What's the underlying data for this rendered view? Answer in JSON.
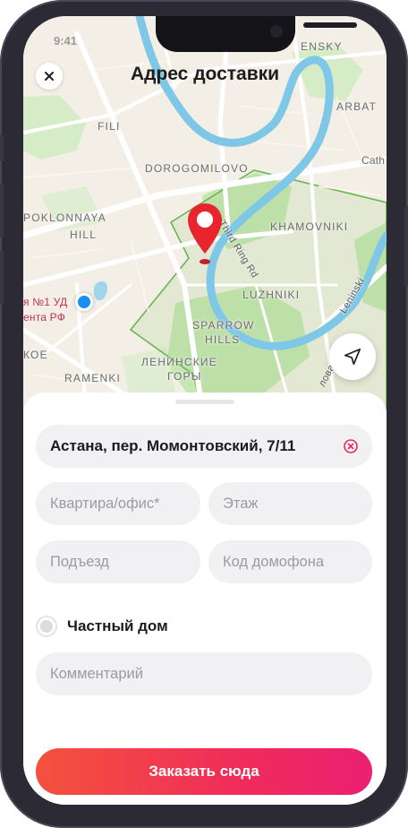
{
  "status": {
    "time": "9:41"
  },
  "header": {
    "title": "Адрес доставки"
  },
  "map": {
    "labels": {
      "fili": "FILI",
      "dorogomilovo": "DOROGOMILOVO",
      "arbat": "ARBAT",
      "cath": "Cath",
      "poklonnaya1": "POKLONNAYA",
      "poklonnaya2": "HILL",
      "khamovniki": "KHAMOVNIKI",
      "third_ring": "Third Ring Rd",
      "luzhniki": "LUZHNIKI",
      "leninski": "Leninski",
      "sparrow1": "SPARROW",
      "sparrow2": "HILLS",
      "lenin1": "ЛЕНИНСКИЕ",
      "lenin2": "ГОРЫ",
      "ramenki": "RAMENKI",
      "koe": "КОЕ",
      "ud": "я №1 УД",
      "rf": "ента РФ",
      "ensky": "ENSKY",
      "lova": "лова"
    },
    "colors": {
      "land": "#f3efe6",
      "park": "#c6e6b3",
      "water": "#7ec7e6",
      "road": "#ffffff",
      "zone": "#69b552",
      "pin": "#e8242e",
      "user_dot": "#1a8ff0"
    }
  },
  "form": {
    "address": "Астана, пер. Момонтовский, 7/11",
    "apartment_placeholder": "Квартира/офис*",
    "floor_placeholder": "Этаж",
    "entrance_placeholder": "Подъезд",
    "intercom_placeholder": "Код домофона",
    "private_house_label": "Частный дом",
    "private_house_checked": false,
    "comment_placeholder": "Комментарий",
    "submit_label": "Заказать сюда"
  }
}
